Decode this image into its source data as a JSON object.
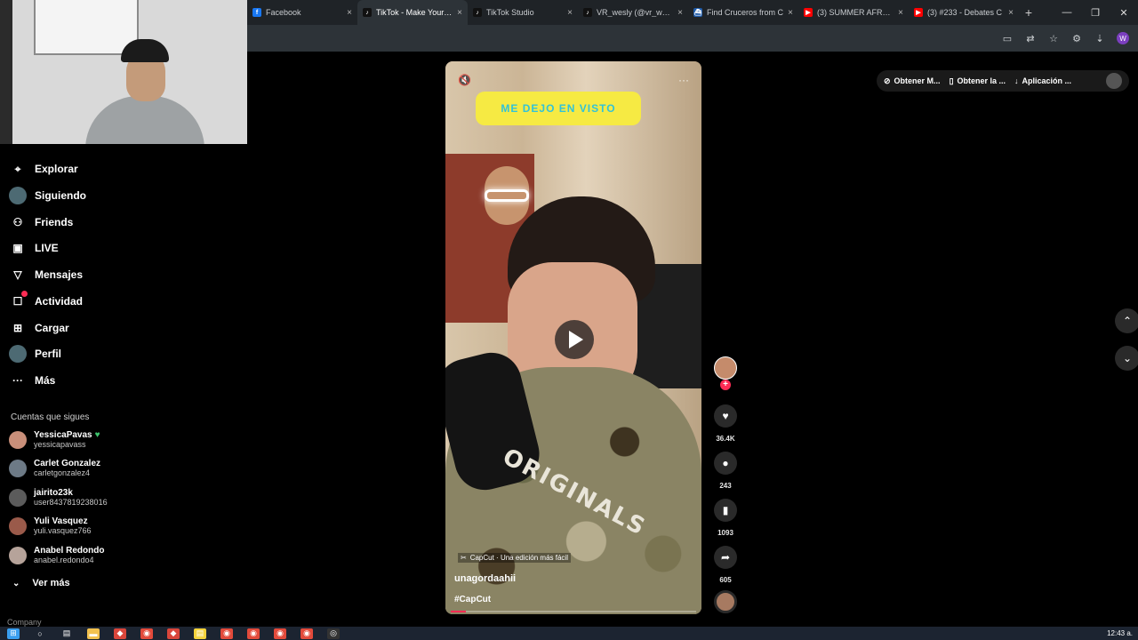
{
  "browser": {
    "tabs": [
      {
        "title": "Facebook",
        "favicon_color": "#1877f2",
        "favicon_glyph": "f",
        "active": false
      },
      {
        "title": "TikTok - Make Your Day",
        "favicon_color": "#111111",
        "favicon_glyph": "♪",
        "active": true
      },
      {
        "title": "TikTok Studio",
        "favicon_color": "#111111",
        "favicon_glyph": "♪",
        "active": false
      },
      {
        "title": "VR_wesly (@vr_wesly)",
        "favicon_color": "#111111",
        "favicon_glyph": "♪",
        "active": false
      },
      {
        "title": "Find Cruceros from C",
        "favicon_color": "#1e5aa8",
        "favicon_glyph": "⛴",
        "active": false
      },
      {
        "title": "(3) SUMMER AFRO H",
        "favicon_color": "#ff0000",
        "favicon_glyph": "▶",
        "active": false
      },
      {
        "title": "(3) #233 - Debates C",
        "favicon_color": "#ff0000",
        "favicon_glyph": "▶",
        "active": false
      }
    ],
    "tab_close_glyph": "×",
    "new_tab_glyph": "+",
    "window_controls": [
      "—",
      "❐",
      "✕"
    ],
    "toolbar_icons": [
      "cast-icon",
      "translate-icon",
      "star-icon",
      "extensions-icon",
      "download-icon"
    ],
    "profile_initial": "W"
  },
  "sidebar": {
    "nav": [
      {
        "label": "Explorar",
        "icon": "compass-icon",
        "glyph": "⌖"
      },
      {
        "label": "Siguiendo",
        "icon": "following-avatar-icon",
        "glyph": ""
      },
      {
        "label": "Friends",
        "icon": "friends-icon",
        "glyph": "⚇"
      },
      {
        "label": "LIVE",
        "icon": "live-icon",
        "glyph": "▣"
      },
      {
        "label": "Mensajes",
        "icon": "messages-icon",
        "glyph": "▽"
      },
      {
        "label": "Actividad",
        "icon": "activity-icon",
        "glyph": "☐"
      },
      {
        "label": "Cargar",
        "icon": "upload-icon",
        "glyph": "⊞"
      },
      {
        "label": "Perfil",
        "icon": "profile-avatar-icon",
        "glyph": ""
      },
      {
        "label": "Más",
        "icon": "more-icon",
        "glyph": "···"
      }
    ],
    "following_title": "Cuentas que sigues",
    "following": [
      {
        "name": "YessicaPavas",
        "handle": "yessicapavass",
        "verified": "♥",
        "avatar_color": "#c98f7a"
      },
      {
        "name": "Carlet Gonzalez",
        "handle": "carletgonzalez4",
        "verified": "",
        "avatar_color": "#6d7a86"
      },
      {
        "name": "jairito23k",
        "handle": "user8437819238016",
        "verified": "",
        "avatar_color": "#5b5b5b"
      },
      {
        "name": "Yuli Vasquez",
        "handle": "yuli.vasquez766",
        "verified": "",
        "avatar_color": "#9a5a4a"
      },
      {
        "name": "Anabel Redondo",
        "handle": "anabel.redondo4",
        "verified": "",
        "avatar_color": "#b6a39a"
      }
    ],
    "see_more": "Ver más",
    "see_more_glyph": "⌄",
    "company": "Company"
  },
  "top_actions": [
    {
      "label": "Obtener M...",
      "glyph": "⊘"
    },
    {
      "label": "Obtener la ...",
      "glyph": "▯"
    },
    {
      "label": "Aplicación ...",
      "glyph": "↓"
    }
  ],
  "video": {
    "banner_text": "ME DEJO EN VISTO",
    "print_text": "ORIGINALS",
    "mute_glyph": "🔇",
    "more_glyph": "···",
    "capcut_label": "CapCut · Una edición más fácil",
    "author": "unagordaahii",
    "hashtag": "#CapCut",
    "progress": 0.06,
    "stats": {
      "likes": "36.4K",
      "comments": "243",
      "saves": "1093",
      "shares": "605"
    },
    "glyphs": {
      "like": "♥",
      "comment": "●",
      "save": "▮",
      "share": "➦",
      "follow_plus": "+"
    }
  },
  "scroll": {
    "up_glyph": "⌃",
    "down_glyph": "⌄"
  },
  "taskbar": {
    "icons": [
      "windows-icon",
      "search-icon",
      "taskview-icon",
      "explorer-icon",
      "app-icon",
      "chrome-icon",
      "app-icon",
      "notes-icon",
      "chrome-icon",
      "chrome-icon",
      "chrome-icon",
      "chrome-icon",
      "obs-icon"
    ],
    "clock": "12:43 a."
  }
}
